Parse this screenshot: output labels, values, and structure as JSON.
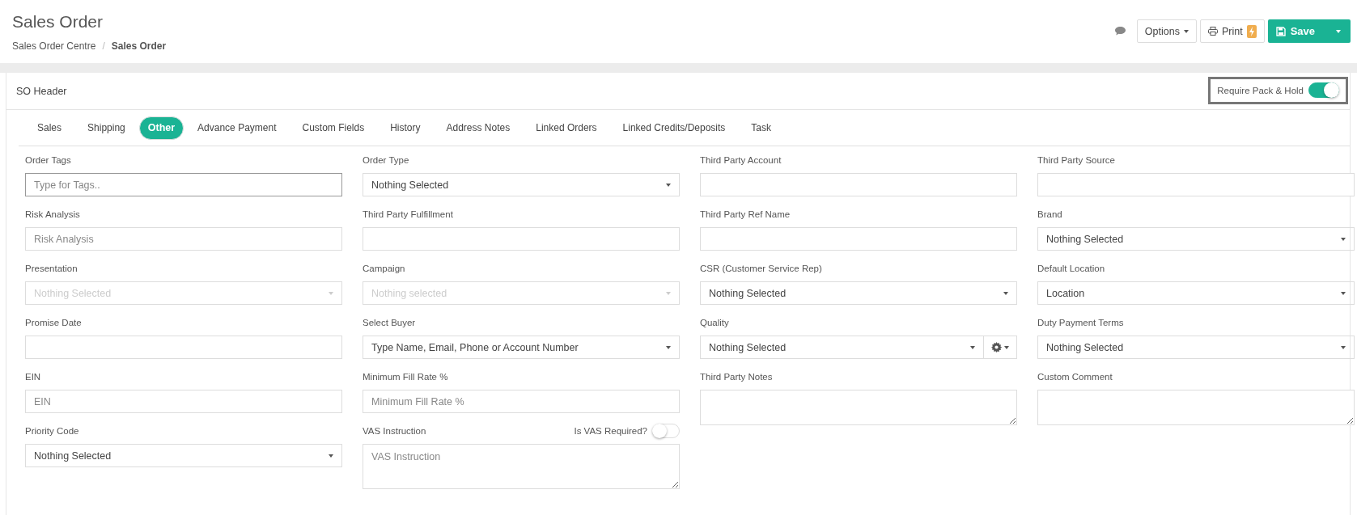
{
  "page": {
    "title": "Sales Order",
    "separator": "/",
    "breadcrumb": [
      {
        "label": "Sales Order Centre",
        "current": false
      },
      {
        "label": "Sales Order",
        "current": true
      }
    ]
  },
  "toolbar": {
    "options": "Options",
    "print": "Print",
    "save": "Save"
  },
  "panel": {
    "title": "SO Header",
    "toggle": {
      "label": "Require Pack & Hold",
      "on": true
    }
  },
  "tabs": [
    {
      "label": "Sales",
      "selected": false
    },
    {
      "label": "Shipping",
      "selected": false
    },
    {
      "label": "Other",
      "selected": true
    },
    {
      "label": "Advance Payment",
      "selected": false
    },
    {
      "label": "Custom Fields",
      "selected": false
    },
    {
      "label": "History",
      "selected": false
    },
    {
      "label": "Address Notes",
      "selected": false
    },
    {
      "label": "Linked Orders",
      "selected": false
    },
    {
      "label": "Linked Credits/Deposits",
      "selected": false
    },
    {
      "label": "Task",
      "selected": false
    }
  ],
  "columns": [
    [
      {
        "kind": "input",
        "label": "Order Tags",
        "placeholder": "Type for Tags.."
      },
      {
        "kind": "input",
        "label": "Risk Analysis",
        "placeholder": "Risk Analysis"
      },
      {
        "kind": "select",
        "label": "Presentation",
        "value": "Nothing Selected",
        "disabled": true
      },
      {
        "kind": "input",
        "label": "Promise Date"
      },
      {
        "kind": "input",
        "label": "EIN",
        "placeholder": "EIN"
      },
      {
        "kind": "select",
        "label": "Priority Code",
        "value": "Nothing Selected",
        "disabled": false
      }
    ],
    [
      {
        "kind": "select",
        "label": "Order Type",
        "value": "Nothing Selected",
        "disabled": false
      },
      {
        "kind": "input",
        "label": "Third Party Fulfillment"
      },
      {
        "kind": "select",
        "label": "Campaign",
        "value": "Nothing selected",
        "disabled": true
      },
      {
        "kind": "select",
        "label": "Select Buyer",
        "value": "Type Name, Email, Phone or Account Number",
        "disabled": false
      },
      {
        "kind": "input",
        "label": "Minimum Fill Rate %",
        "placeholder": "Minimum Fill Rate %"
      },
      {
        "kind": "textarea",
        "label": "VAS Instruction",
        "placeholder": "VAS Instruction",
        "toggle": {
          "label": "Is VAS Required?",
          "on": false
        }
      }
    ],
    [
      {
        "kind": "input",
        "label": "Third Party Account"
      },
      {
        "kind": "input",
        "label": "Third Party Ref Name"
      },
      {
        "kind": "select",
        "label": "CSR (Customer Service Rep)",
        "value": "Nothing Selected",
        "disabled": false
      },
      {
        "kind": "select-gear",
        "label": "Quality",
        "value": "Nothing Selected",
        "disabled": false
      },
      {
        "kind": "textarea",
        "label": "Third Party Notes"
      }
    ],
    [
      {
        "kind": "input",
        "label": "Third Party Source"
      },
      {
        "kind": "select",
        "label": "Brand",
        "value": "Nothing Selected",
        "disabled": false
      },
      {
        "kind": "select",
        "label": "Default Location",
        "value": "Location",
        "disabled": false
      },
      {
        "kind": "select",
        "label": "Duty Payment Terms",
        "value": "Nothing Selected",
        "disabled": false
      },
      {
        "kind": "textarea",
        "label": "Custom Comment"
      }
    ]
  ]
}
